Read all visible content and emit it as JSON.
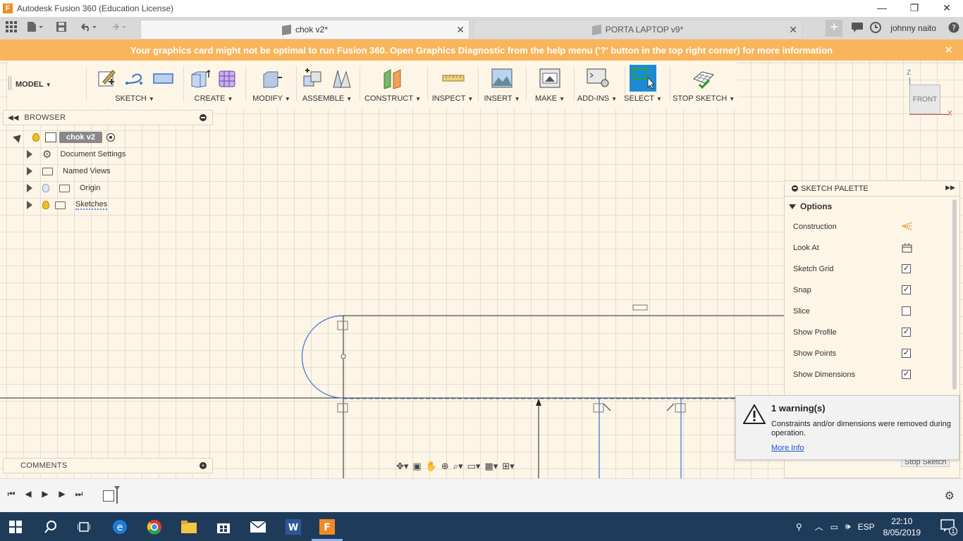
{
  "window": {
    "title": "Autodesk Fusion 360 (Education License)",
    "app_icon_letter": "F",
    "minimize": "—",
    "maximize": "❐",
    "close": "✕"
  },
  "tabs": [
    {
      "label": "chok v2*",
      "active": true
    },
    {
      "label": "PORTA LAPTOP v9*",
      "active": false
    }
  ],
  "header_right": {
    "user": "johnny naito"
  },
  "banner": {
    "text": "Your graphics card might not be optimal to run Fusion 360. Open Graphics Diagnostic from the help menu ('?' button in the top right corner) for more information",
    "close": "✕",
    "color": "#f9b55c"
  },
  "workspace": {
    "label": "MODEL"
  },
  "toolbar": {
    "groups": [
      "SKETCH",
      "CREATE",
      "MODIFY",
      "ASSEMBLE",
      "CONSTRUCT",
      "INSPECT",
      "INSERT",
      "MAKE",
      "ADD-INS",
      "SELECT",
      "STOP SKETCH"
    ]
  },
  "browser": {
    "title": "BROWSER",
    "root": "chok v2",
    "items": [
      "Document Settings",
      "Named Views",
      "Origin",
      "Sketches"
    ]
  },
  "viewcube": {
    "face": "FRONT",
    "axis_z": "Z",
    "axis_x": "X"
  },
  "palette": {
    "title": "SKETCH PALETTE",
    "section": "Options",
    "options": [
      {
        "label": "Construction",
        "control": "construction-icon"
      },
      {
        "label": "Look At",
        "control": "look-at-icon"
      },
      {
        "label": "Sketch Grid",
        "checked": true
      },
      {
        "label": "Snap",
        "checked": true
      },
      {
        "label": "Slice",
        "checked": false
      },
      {
        "label": "Show Profile",
        "checked": true
      },
      {
        "label": "Show Points",
        "checked": true
      },
      {
        "label": "Show Dimensions",
        "checked": true
      }
    ]
  },
  "warning": {
    "title": "1 warning(s)",
    "message": "Constraints and/or dimensions were removed during operation.",
    "link": "More Info",
    "stop_sketch": "Stop Sketch"
  },
  "comments": {
    "title": "COMMENTS"
  },
  "taskbar": {
    "language": "ESP",
    "time": "22:10",
    "date": "8/05/2019",
    "notifications": "1"
  }
}
